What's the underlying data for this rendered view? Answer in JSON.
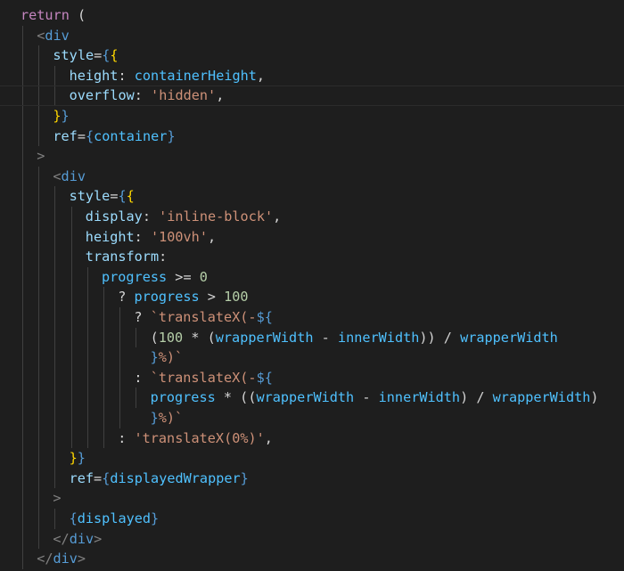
{
  "editor": {
    "lines": [
      {
        "indent": 1,
        "tokens": [
          {
            "t": "return ",
            "c": "kw"
          },
          {
            "t": "(",
            "c": "plain"
          }
        ]
      },
      {
        "indent": 2,
        "tokens": [
          {
            "t": "<",
            "c": "punc"
          },
          {
            "t": "div",
            "c": "tag"
          }
        ]
      },
      {
        "indent": 3,
        "tokens": [
          {
            "t": "style",
            "c": "attr"
          },
          {
            "t": "=",
            "c": "plain"
          },
          {
            "t": "{",
            "c": "tag"
          },
          {
            "t": "{",
            "c": "brace"
          }
        ]
      },
      {
        "indent": 4,
        "tokens": [
          {
            "t": "height",
            "c": "attr"
          },
          {
            "t": ": ",
            "c": "plain"
          },
          {
            "t": "containerHeight",
            "c": "var"
          },
          {
            "t": ",",
            "c": "plain"
          }
        ]
      },
      {
        "indent": 4,
        "current": true,
        "tokens": [
          {
            "t": "overflow",
            "c": "attr"
          },
          {
            "t": ": ",
            "c": "plain"
          },
          {
            "t": "'hidden'",
            "c": "str"
          },
          {
            "t": ",",
            "c": "plain"
          }
        ]
      },
      {
        "indent": 3,
        "tokens": [
          {
            "t": "}",
            "c": "brace"
          },
          {
            "t": "}",
            "c": "tag"
          }
        ]
      },
      {
        "indent": 3,
        "tokens": [
          {
            "t": "ref",
            "c": "attr"
          },
          {
            "t": "=",
            "c": "plain"
          },
          {
            "t": "{",
            "c": "tag"
          },
          {
            "t": "container",
            "c": "var"
          },
          {
            "t": "}",
            "c": "tag"
          }
        ]
      },
      {
        "indent": 2,
        "tokens": [
          {
            "t": ">",
            "c": "punc"
          }
        ]
      },
      {
        "indent": 3,
        "tokens": [
          {
            "t": "<",
            "c": "punc"
          },
          {
            "t": "div",
            "c": "tag"
          }
        ]
      },
      {
        "indent": 4,
        "tokens": [
          {
            "t": "style",
            "c": "attr"
          },
          {
            "t": "=",
            "c": "plain"
          },
          {
            "t": "{",
            "c": "tag"
          },
          {
            "t": "{",
            "c": "brace"
          }
        ]
      },
      {
        "indent": 5,
        "tokens": [
          {
            "t": "display",
            "c": "attr"
          },
          {
            "t": ": ",
            "c": "plain"
          },
          {
            "t": "'inline-block'",
            "c": "str"
          },
          {
            "t": ",",
            "c": "plain"
          }
        ]
      },
      {
        "indent": 5,
        "tokens": [
          {
            "t": "height",
            "c": "attr"
          },
          {
            "t": ": ",
            "c": "plain"
          },
          {
            "t": "'100vh'",
            "c": "str"
          },
          {
            "t": ",",
            "c": "plain"
          }
        ]
      },
      {
        "indent": 5,
        "tokens": [
          {
            "t": "transform",
            "c": "attr"
          },
          {
            "t": ":",
            "c": "plain"
          }
        ]
      },
      {
        "indent": 6,
        "tokens": [
          {
            "t": "progress",
            "c": "var"
          },
          {
            "t": " >= ",
            "c": "plain"
          },
          {
            "t": "0",
            "c": "num"
          }
        ]
      },
      {
        "indent": 7,
        "tokens": [
          {
            "t": "? ",
            "c": "plain"
          },
          {
            "t": "progress",
            "c": "var"
          },
          {
            "t": " > ",
            "c": "plain"
          },
          {
            "t": "100",
            "c": "num"
          }
        ]
      },
      {
        "indent": 8,
        "tokens": [
          {
            "t": "? ",
            "c": "plain"
          },
          {
            "t": "`translateX(-",
            "c": "str"
          },
          {
            "t": "${",
            "c": "tag"
          }
        ]
      },
      {
        "indent": 9,
        "tokens": [
          {
            "t": "(",
            "c": "plain"
          },
          {
            "t": "100",
            "c": "num"
          },
          {
            "t": " * (",
            "c": "plain"
          },
          {
            "t": "wrapperWidth",
            "c": "var"
          },
          {
            "t": " - ",
            "c": "plain"
          },
          {
            "t": "innerWidth",
            "c": "var"
          },
          {
            "t": ")) / ",
            "c": "plain"
          },
          {
            "t": "wrapperWidth",
            "c": "var"
          }
        ]
      },
      {
        "indent": 8,
        "offset": 1,
        "tokens": [
          {
            "t": "}",
            "c": "tag"
          },
          {
            "t": "%)`",
            "c": "str"
          }
        ]
      },
      {
        "indent": 8,
        "tokens": [
          {
            "t": ": ",
            "c": "plain"
          },
          {
            "t": "`translateX(-",
            "c": "str"
          },
          {
            "t": "${",
            "c": "tag"
          }
        ]
      },
      {
        "indent": 9,
        "tokens": [
          {
            "t": "progress",
            "c": "var"
          },
          {
            "t": " * ((",
            "c": "plain"
          },
          {
            "t": "wrapperWidth",
            "c": "var"
          },
          {
            "t": " - ",
            "c": "plain"
          },
          {
            "t": "innerWidth",
            "c": "var"
          },
          {
            "t": ") / ",
            "c": "plain"
          },
          {
            "t": "wrapperWidth",
            "c": "var"
          },
          {
            "t": ")",
            "c": "plain"
          }
        ]
      },
      {
        "indent": 8,
        "offset": 1,
        "tokens": [
          {
            "t": "}",
            "c": "tag"
          },
          {
            "t": "%)`",
            "c": "str"
          }
        ]
      },
      {
        "indent": 7,
        "tokens": [
          {
            "t": ": ",
            "c": "plain"
          },
          {
            "t": "'translateX(0%)'",
            "c": "str"
          },
          {
            "t": ",",
            "c": "plain"
          }
        ]
      },
      {
        "indent": 4,
        "tokens": [
          {
            "t": "}",
            "c": "brace"
          },
          {
            "t": "}",
            "c": "tag"
          }
        ]
      },
      {
        "indent": 4,
        "tokens": [
          {
            "t": "ref",
            "c": "attr"
          },
          {
            "t": "=",
            "c": "plain"
          },
          {
            "t": "{",
            "c": "tag"
          },
          {
            "t": "displayedWrapper",
            "c": "var"
          },
          {
            "t": "}",
            "c": "tag"
          }
        ]
      },
      {
        "indent": 3,
        "tokens": [
          {
            "t": ">",
            "c": "punc"
          }
        ]
      },
      {
        "indent": 4,
        "tokens": [
          {
            "t": "{",
            "c": "tag"
          },
          {
            "t": "displayed",
            "c": "var"
          },
          {
            "t": "}",
            "c": "tag"
          }
        ]
      },
      {
        "indent": 3,
        "tokens": [
          {
            "t": "</",
            "c": "punc"
          },
          {
            "t": "div",
            "c": "tag"
          },
          {
            "t": ">",
            "c": "punc"
          }
        ]
      },
      {
        "indent": 2,
        "tokens": [
          {
            "t": "</",
            "c": "punc"
          },
          {
            "t": "div",
            "c": "tag"
          },
          {
            "t": ">",
            "c": "punc"
          }
        ]
      }
    ]
  }
}
